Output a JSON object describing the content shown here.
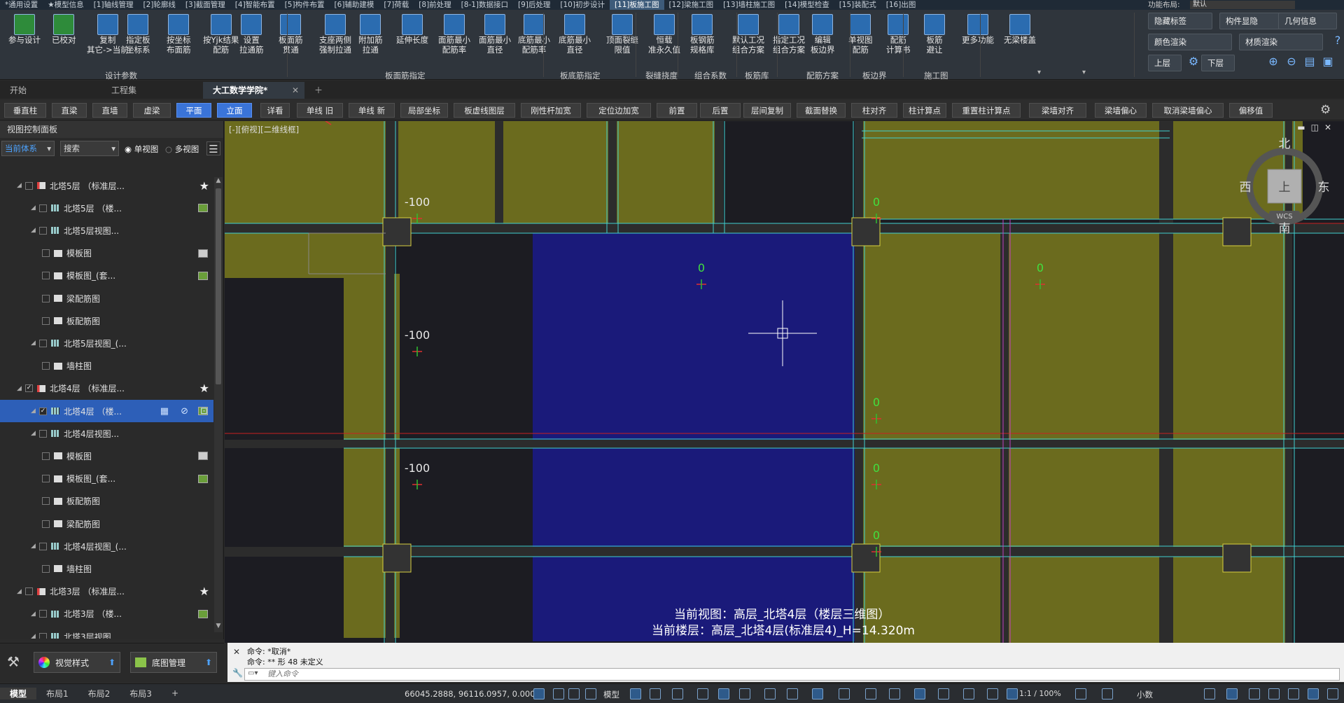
{
  "menubar": {
    "items": [
      "*通用设置",
      "★模型信息",
      "[1]轴线管理",
      "[2]轮廓线",
      "[3]截面管理",
      "[4]智能布置",
      "[5]构件布置",
      "[6]辅助建模",
      "[7]荷载",
      "[8]前处理",
      "[8-1]数据接口",
      "[9]后处理",
      "[10]初步设计",
      "[11]板施工图",
      "[12]梁施工图",
      "[13]墙柱施工图",
      "[14]模型检查",
      "[15]装配式",
      "[16]出图"
    ],
    "active_index": 13,
    "layout_label": "功能布局:",
    "layout_value": "默认"
  },
  "ribbon": {
    "buttons": [
      {
        "label1": "参与设计",
        "label2": ""
      },
      {
        "label1": "已校对",
        "label2": ""
      },
      {
        "label1": "复制",
        "label2": "其它->当前"
      },
      {
        "label1": "指定板",
        "label2": "坐标系"
      },
      {
        "label1": "按坐标",
        "label2": "布面筋"
      },
      {
        "label1": "按Yjk结果",
        "label2": "配筋"
      },
      {
        "label1": "设置",
        "label2": "拉通筋"
      },
      {
        "label1": "板面筋",
        "label2": "贯通"
      },
      {
        "label1": "支座两侧",
        "label2": "强制拉通"
      },
      {
        "label1": "附加筋",
        "label2": "拉通"
      },
      {
        "label1": "延伸长度",
        "label2": ""
      },
      {
        "label1": "面筋最小",
        "label2": "配筋率"
      },
      {
        "label1": "面筋最小",
        "label2": "直径"
      },
      {
        "label1": "底筋最小",
        "label2": "配筋率"
      },
      {
        "label1": "底筋最小",
        "label2": "直径"
      },
      {
        "label1": "顶面裂缝",
        "label2": "限值"
      },
      {
        "label1": "恒载",
        "label2": "准永久值"
      },
      {
        "label1": "板钢筋",
        "label2": "规格库"
      },
      {
        "label1": "默认工况",
        "label2": "组合方案"
      },
      {
        "label1": "指定工况",
        "label2": "组合方案"
      },
      {
        "label1": "编辑",
        "label2": "板边界"
      },
      {
        "label1": "单视图",
        "label2": "配筋"
      },
      {
        "label1": "配筋",
        "label2": "计算书"
      },
      {
        "label1": "板筋",
        "label2": "避让"
      },
      {
        "label1": "更多功能",
        "label2": ""
      },
      {
        "label1": "无梁楼盖",
        "label2": ""
      }
    ],
    "groups": [
      "设计参数",
      "板面筋指定",
      "板底筋指定",
      "裂缝挠度",
      "组合系数",
      "板筋库",
      "配筋方案",
      "板边界",
      "施工图"
    ],
    "right": {
      "hide_label": "隐藏标签",
      "show_comp": "构件显隐",
      "geo_info": "几何信息",
      "color_render": "颜色渲染",
      "material_render": "材质渲染",
      "floor_up": "上层",
      "floor_down": "下层"
    }
  },
  "tabs": [
    "开始",
    "工程集",
    "大工数学学院*"
  ],
  "cmdbar": {
    "buttons": [
      "垂直柱",
      "直梁",
      "直墙",
      "虚梁",
      "平面",
      "立面",
      "详看",
      "单线 旧",
      "单线 新",
      "局部坐标",
      "板虚线图层",
      "刚性杆加宽",
      "定位边加宽",
      "前置",
      "后置",
      "层间复制",
      "截面替换",
      "柱对齐",
      "柱计算点",
      "重置柱计算点",
      "梁墙对齐",
      "梁墙偏心",
      "取消梁墙偏心",
      "偏移值"
    ],
    "selected": [
      4,
      5
    ]
  },
  "panel": {
    "title": "视图控制面板",
    "system": "当前体系",
    "search": "搜索",
    "single_view": "单视图",
    "multi_view": "多视图",
    "tree": [
      {
        "label": "北塔5层 （标准层...",
        "level": 1,
        "star": true,
        "checked": false
      },
      {
        "label": "北塔5层 （楼...",
        "level": 2,
        "checked": false
      },
      {
        "label": "北塔5层视图...",
        "level": 2,
        "checked": false
      },
      {
        "label": "模板图",
        "level": 3,
        "checked": false
      },
      {
        "label": "模板图_(套...",
        "level": 3,
        "checked": false
      },
      {
        "label": "梁配筋图",
        "level": 3,
        "checked": false
      },
      {
        "label": "板配筋图",
        "level": 3,
        "checked": false
      },
      {
        "label": "北塔5层视图_(...",
        "level": 2,
        "checked": false
      },
      {
        "label": "墙柱图",
        "level": 3,
        "checked": false
      },
      {
        "label": "北塔4层 （标准层...",
        "level": 1,
        "star": true,
        "checked": true
      },
      {
        "label": "北塔4层 （楼...",
        "level": 2,
        "checked": true,
        "selected": true
      },
      {
        "label": "北塔4层视图...",
        "level": 2,
        "checked": false
      },
      {
        "label": "模板图",
        "level": 3,
        "checked": false
      },
      {
        "label": "模板图_(套...",
        "level": 3,
        "checked": false
      },
      {
        "label": "板配筋图",
        "level": 3,
        "checked": false
      },
      {
        "label": "梁配筋图",
        "level": 3,
        "checked": false
      },
      {
        "label": "北塔4层视图_(...",
        "level": 2,
        "checked": false
      },
      {
        "label": "墙柱图",
        "level": 3,
        "checked": false
      },
      {
        "label": "北塔3层 （标准层...",
        "level": 1,
        "star": true,
        "checked": false
      },
      {
        "label": "北塔3层 （楼...",
        "level": 2,
        "checked": false
      },
      {
        "label": "北塔3层视图...",
        "level": 2,
        "checked": false
      }
    ],
    "visual_style": "视觉样式",
    "base_map": "底图管理"
  },
  "canvas": {
    "view_label": "[-][俯视][二维线框]",
    "compass": {
      "north": "北",
      "south": "南",
      "east": "东",
      "west": "西",
      "top": "上",
      "wcs": "WCS"
    },
    "slab_labels": [
      "0",
      "0",
      "-100",
      "0",
      "0",
      "0",
      "0",
      "-100",
      "0",
      "0",
      "-100",
      "0"
    ],
    "info_view": "当前视图：高层_北塔4层（楼层三维图）",
    "info_floor": "当前楼层：高层_北塔4层(标准层4)_H=14.320m"
  },
  "cmdlog": {
    "line1": "命令: *取消*",
    "line2": "命令:  ** 形 48 未定义",
    "input_placeholder": "键入命令"
  },
  "statusbar": {
    "coords": "66045.2888, 96116.0957, 0.0000",
    "mode": "模型",
    "scale": "1:1 / 100%",
    "units": "小数"
  },
  "bottom_tabs": [
    "模型",
    "布局1",
    "布局2",
    "布局3",
    "+"
  ],
  "colors": {
    "slab_olive": "#6b6b1e",
    "slab_selected": "#1a1a7a",
    "beam": "#3a3a3a",
    "accent": "#3a74d8",
    "cyan": "#40d0d0",
    "yellow": "#d8d040"
  }
}
